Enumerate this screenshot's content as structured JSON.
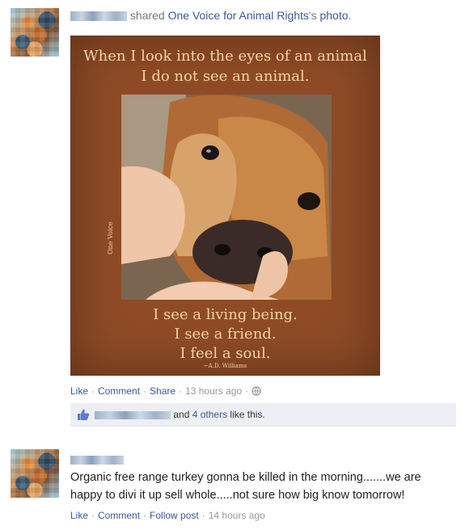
{
  "post1": {
    "shared_text": "shared",
    "page_name": "One Voice for Animal Rights",
    "possessive": "'s",
    "photo_link": "photo",
    "period": ".",
    "poster": {
      "quote_line1": "When I look into the eyes of an animal",
      "quote_line2": "I do not see an animal.",
      "bottom_line1": "I see a living being.",
      "bottom_line2": "I see a friend.",
      "bottom_line3": "I feel a soul.",
      "attribution": "~A.D. Williams",
      "brand": "One Voice"
    },
    "actions": {
      "like": "Like",
      "comment": "Comment",
      "share": "Share",
      "time": "13 hours ago"
    },
    "likes": {
      "and_text": "and",
      "others_link": "4 others",
      "suffix": "like this."
    }
  },
  "post2": {
    "text_line1": "Organic free range turkey gonna be killed in the morning.......we are",
    "text_line2": "happy to divi it up sell whole.....not sure how big know tomorrow!",
    "actions": {
      "like": "Like",
      "comment": "Comment",
      "follow": "Follow post",
      "time": "14 hours ago"
    }
  },
  "colors": {
    "link": "#3b5998",
    "poster_bg": "#8f4b26",
    "poster_text": "#f4d3a3",
    "likebox_bg": "#edeff4"
  }
}
